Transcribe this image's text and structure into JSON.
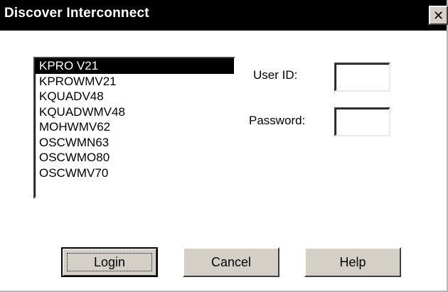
{
  "window": {
    "title": "Discover Interconnect",
    "close_label": "✕"
  },
  "listbox": {
    "items": [
      "KPRO V21",
      "KPROWMV21",
      "KQUADV48",
      "KQUADWMV48",
      "MOHWMV62",
      "OSCWMN63",
      "OSCWMO80",
      "OSCWMV70"
    ],
    "selected_index": 0
  },
  "form": {
    "user_id_label": "User ID:",
    "user_id_value": "",
    "password_label": "Password:",
    "password_value": ""
  },
  "buttons": {
    "login": "Login",
    "cancel": "Cancel",
    "help": "Help"
  },
  "colors": {
    "titlebar_bg": "#000000",
    "selection_bg": "#000000",
    "button_face": "#d4d0c8"
  }
}
